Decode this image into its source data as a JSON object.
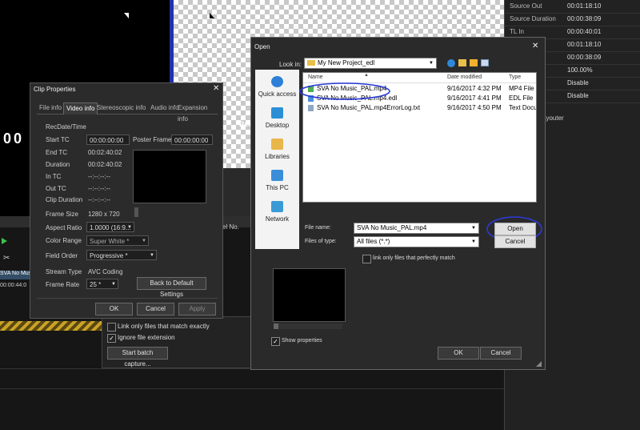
{
  "right_panel": {
    "rows": [
      {
        "label": "Source Out",
        "value": "00:01:18:10"
      },
      {
        "label": "Source Duration",
        "value": "00:00:38:09"
      },
      {
        "label": "TL In",
        "value": "00:00:40:01"
      },
      {
        "label": "",
        "value": "00:01:18:10"
      },
      {
        "label": "",
        "value": "00:00:38:09"
      },
      {
        "label": "",
        "value": "100.00%"
      },
      {
        "label": "",
        "value": "Disable"
      },
      {
        "label": "",
        "value": "Disable"
      }
    ],
    "partial_label": "ayouter"
  },
  "background": {
    "timecode": "00",
    "timecode_small": "00:00:44:0",
    "clip_label": "SVA No Music_",
    "preview_text": "Rec",
    "col_header": "el No."
  },
  "clip_properties": {
    "title": "Clip Properties",
    "tabs": [
      "File info",
      "Video info",
      "Stereoscopic info",
      "Audio info",
      "Expansion info"
    ],
    "active_tab": 1,
    "section": "RecDate/Time",
    "start_tc_label": "Start TC",
    "start_tc": "00:00:00:00",
    "poster_label": "Poster Frame",
    "poster": "00:00:00:00",
    "end_tc_label": "End TC",
    "end_tc": "00:02:40:02",
    "duration_label": "Duration",
    "duration": "00:02:40:02",
    "in_tc_label": "In TC",
    "in_tc": "--:--:--:--",
    "out_tc_label": "Out TC",
    "out_tc": "--:--:--:--",
    "clip_dur_label": "Clip Duration",
    "clip_dur": "--:--:--:--",
    "frame_size_label": "Frame Size",
    "frame_size": "1280 x 720",
    "aspect_label": "Aspect Ratio",
    "aspect": "1.0000 (16:9...",
    "color_range_label": "Color Range",
    "color_range": "Super White *",
    "field_order_label": "Field Order",
    "field_order": "Progressive *",
    "stream_type_label": "Stream Type",
    "stream_type": "AVC Coding",
    "frame_rate_label": "Frame Rate",
    "frame_rate": "25 *",
    "default_btn": "Back to Default Settings",
    "ok": "OK",
    "cancel": "Cancel",
    "apply": "Apply"
  },
  "batch": {
    "link_only": "Link only files that match exactly",
    "ignore_ext": "Ignore file extension",
    "ignore_checked": true,
    "capture_btn": "Start batch capture..."
  },
  "open_dialog": {
    "title": "Open",
    "look_in_label": "Look in:",
    "look_in_value": "My New Project_edl",
    "places": [
      "Quick access",
      "Desktop",
      "Libraries",
      "This PC",
      "Network"
    ],
    "columns": [
      "Name",
      "Date modified",
      "Type"
    ],
    "files": [
      {
        "name": "SVA No Music_PAL.mp4",
        "date": "9/16/2017 4:32 PM",
        "type": "MP4 File"
      },
      {
        "name": "SVA No Music_PAL.mp4.edl",
        "date": "9/16/2017 4:41 PM",
        "type": "EDL File"
      },
      {
        "name": "SVA No Music_PAL.mp4ErrorLog.txt",
        "date": "9/16/2017 4:50 PM",
        "type": "Text Docu"
      }
    ],
    "file_name_label": "File name:",
    "file_name_value": "SVA No Music_PAL.mp4",
    "file_type_label": "Files of type:",
    "file_type_value": "All files (*.*)",
    "open_btn": "Open",
    "cancel_btn": "Cancel",
    "link_only": "link only files that perfectly match",
    "show_props": "Show properties",
    "show_props_checked": true,
    "ok": "OK",
    "cancel2": "Cancel",
    "annotation_color": "#2a3bd6"
  }
}
